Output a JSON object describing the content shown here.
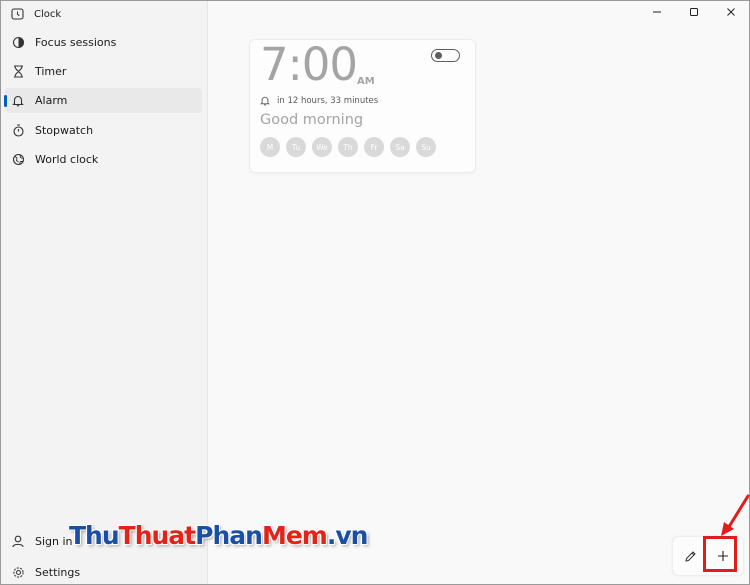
{
  "app": {
    "title": "Clock"
  },
  "nav": {
    "items": [
      {
        "label": "Focus sessions",
        "icon": "focus-icon"
      },
      {
        "label": "Timer",
        "icon": "hourglass-icon"
      },
      {
        "label": "Alarm",
        "icon": "bell-icon",
        "active": true
      },
      {
        "label": "Stopwatch",
        "icon": "stopwatch-icon"
      },
      {
        "label": "World clock",
        "icon": "globe-icon"
      }
    ],
    "sign_in": "Sign in",
    "settings": "Settings"
  },
  "alarm": {
    "time": "7:00",
    "ampm": "AM",
    "remaining": "in 12 hours, 33 minutes",
    "name": "Good morning",
    "enabled": false,
    "days": [
      "M",
      "Tu",
      "We",
      "Th",
      "Fr",
      "Sa",
      "Su"
    ]
  },
  "watermark": {
    "part1": "Thu",
    "part2": "Thuat",
    "part3": "Phan",
    "part4": "Mem",
    "part5": ".vn"
  },
  "colors": {
    "accent": "#005fb8",
    "highlight": "#e31b1b",
    "watermark_blue": "#1a4fa3",
    "watermark_red": "#e2231a"
  }
}
